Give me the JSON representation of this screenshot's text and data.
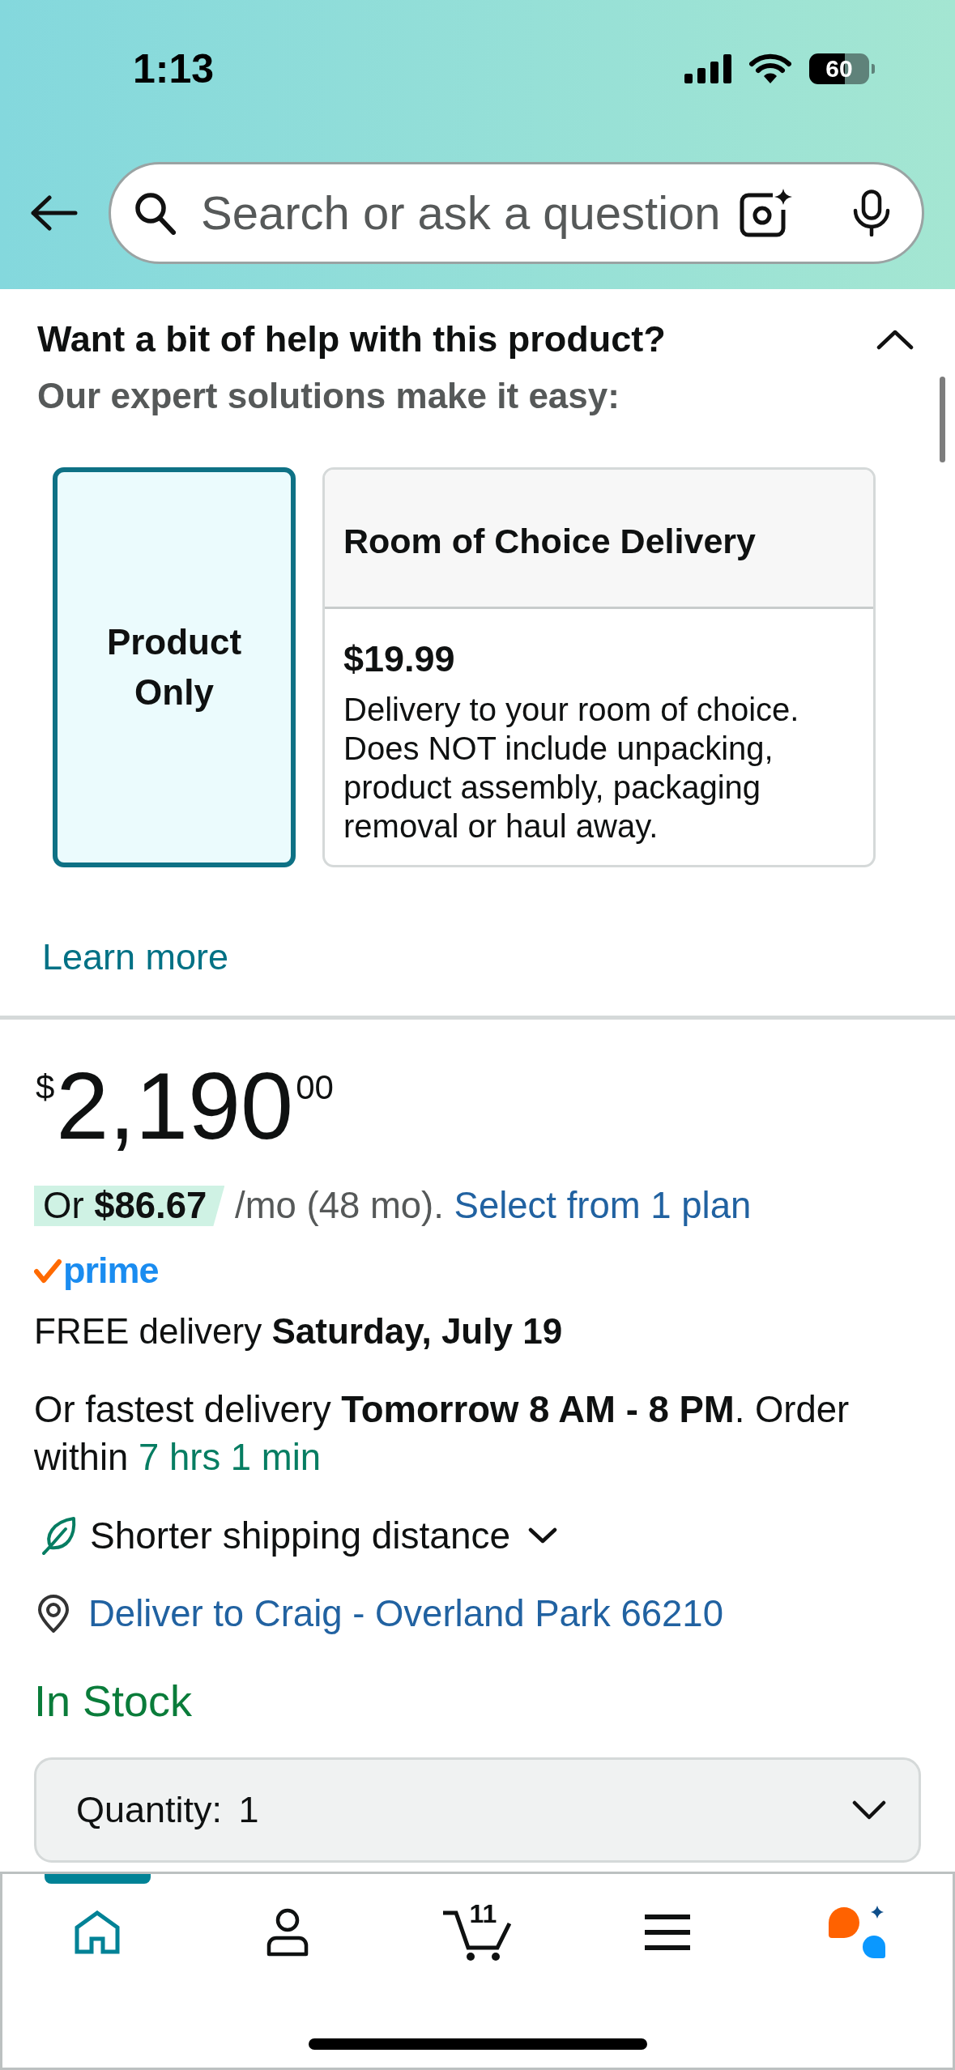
{
  "status_bar": {
    "time": "1:13",
    "battery": "60"
  },
  "search_bar": {
    "placeholder": "Search or ask a question"
  },
  "help_section": {
    "title": "Want a bit of help with this product?",
    "expanded": true,
    "subtitle": "Our expert solutions make it easy:",
    "options": [
      {
        "kind": "simple",
        "label": "Product Only",
        "selected": true
      },
      {
        "kind": "detailed",
        "label": "Room of Choice Delivery",
        "price": "$19.99",
        "description": "Delivery to your room of choice. Does NOT include unpacking, product assembly, packaging removal or haul away.",
        "selected": false
      }
    ],
    "link": "Learn more"
  },
  "price": {
    "currency": "$",
    "whole": "2,190",
    "fraction": "00"
  },
  "financing": {
    "offer": "Or **$86.67**",
    "terms": "/mo (48 mo).",
    "link": "Select from 1 plan"
  },
  "prime_badge": {
    "label": "prime"
  },
  "delivery": {
    "free": "FREE delivery **Saturday, July 19**",
    "fastest": "Or fastest delivery **Tomorrow 8 AM - 8 PM**. Order within",
    "countdown": "7 hrs 1 min"
  },
  "sustainability": {
    "label": "Shorter shipping distance",
    "expanded": false
  },
  "location": {
    "label": "Deliver to Craig - Overland Park 66210"
  },
  "stock": {
    "label": "In Stock"
  },
  "quantity": {
    "label": "Quantity:",
    "value": "1"
  },
  "bottom_nav": {
    "items": [
      {
        "kind": "home",
        "selected": true
      },
      {
        "kind": "account",
        "selected": false
      },
      {
        "kind": "cart",
        "selected": false,
        "count": "11"
      },
      {
        "kind": "menu",
        "selected": false
      },
      {
        "kind": "assistant",
        "selected": false
      }
    ]
  }
}
